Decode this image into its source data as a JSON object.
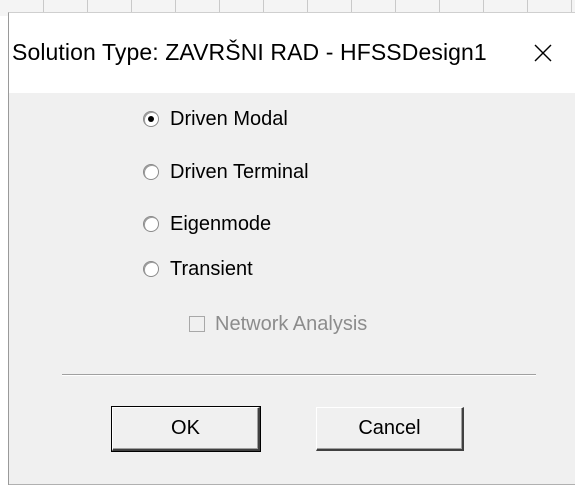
{
  "dialog": {
    "title": "Solution Type: ZAVRŠNI RAD - HFSSDesign1",
    "close_icon": "close-icon"
  },
  "options": [
    {
      "label": "Driven Modal",
      "checked": true
    },
    {
      "label": "Driven Terminal",
      "checked": false
    },
    {
      "label": "Eigenmode",
      "checked": false
    },
    {
      "label": "Transient",
      "checked": false
    }
  ],
  "network_analysis": {
    "label": "Network Analysis",
    "checked": false,
    "enabled": false
  },
  "buttons": {
    "ok_label": "OK",
    "cancel_label": "Cancel"
  },
  "colors": {
    "dialog_bg": "#f0f0f0",
    "titlebar_bg": "#ffffff",
    "disabled_text": "#8c8c8c"
  }
}
